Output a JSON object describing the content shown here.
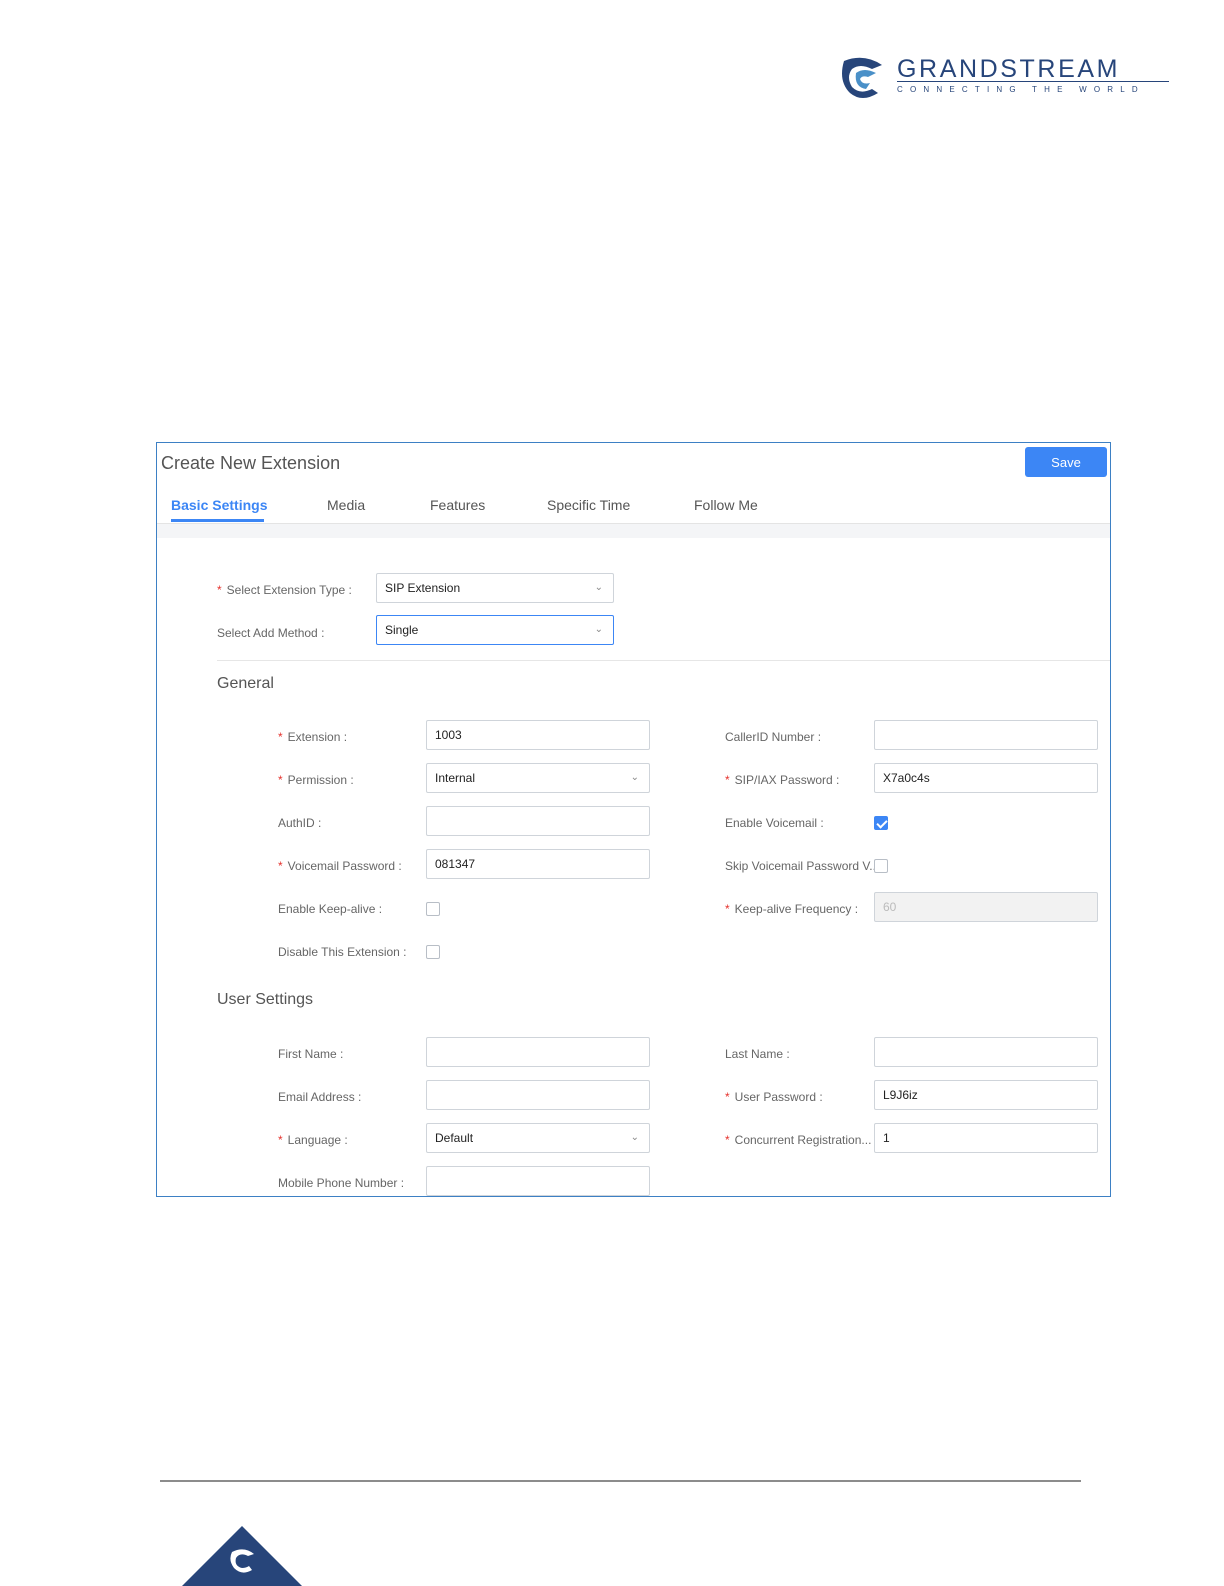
{
  "brand": {
    "name": "GRANDSTREAM",
    "tagline": "CONNECTING THE WORLD"
  },
  "panel": {
    "title": "Create New Extension",
    "save_label": "Save",
    "tabs": [
      "Basic Settings",
      "Media",
      "Features",
      "Specific Time",
      "Follow Me"
    ],
    "active_tab": "Basic Settings"
  },
  "top_form": {
    "extension_type": {
      "label": "Select Extension Type",
      "value": "SIP Extension",
      "required": true
    },
    "add_method": {
      "label": "Select Add Method",
      "value": "Single",
      "required": false
    }
  },
  "general": {
    "section_title": "General",
    "extension": {
      "label": "Extension",
      "value": "1003"
    },
    "permission": {
      "label": "Permission",
      "value": "Internal"
    },
    "authid": {
      "label": "AuthID",
      "value": ""
    },
    "voicemail_password": {
      "label": "Voicemail Password",
      "value": "081347"
    },
    "enable_keepalive": {
      "label": "Enable Keep-alive",
      "checked": false
    },
    "disable_extension": {
      "label": "Disable This Extension",
      "checked": false
    },
    "callerid_number": {
      "label": "CallerID Number",
      "value": ""
    },
    "sip_iax_password": {
      "label": "SIP/IAX Password",
      "value": "X7a0c4s"
    },
    "enable_voicemail": {
      "label": "Enable Voicemail",
      "checked": true
    },
    "skip_voicemail_password": {
      "label": "Skip Voicemail Password V...",
      "checked": false
    },
    "keepalive_frequency": {
      "label": "Keep-alive Frequency",
      "value": "60",
      "disabled": true
    }
  },
  "user_settings": {
    "section_title": "User Settings",
    "first_name": {
      "label": "First Name",
      "value": ""
    },
    "email_address": {
      "label": "Email Address",
      "value": ""
    },
    "language": {
      "label": "Language",
      "value": "Default"
    },
    "mobile_phone": {
      "label": "Mobile Phone Number",
      "value": ""
    },
    "last_name": {
      "label": "Last Name",
      "value": ""
    },
    "user_password": {
      "label": "User Password",
      "value": "L9J6iz"
    },
    "concurrent_registrations": {
      "label": "Concurrent Registration...",
      "value": "1"
    }
  },
  "colors": {
    "accent": "#3c86f5",
    "required": "#e5322d",
    "brand": "#27457a"
  },
  "icons": {
    "dropdown": "chevron-down-icon",
    "check": "check-icon"
  }
}
